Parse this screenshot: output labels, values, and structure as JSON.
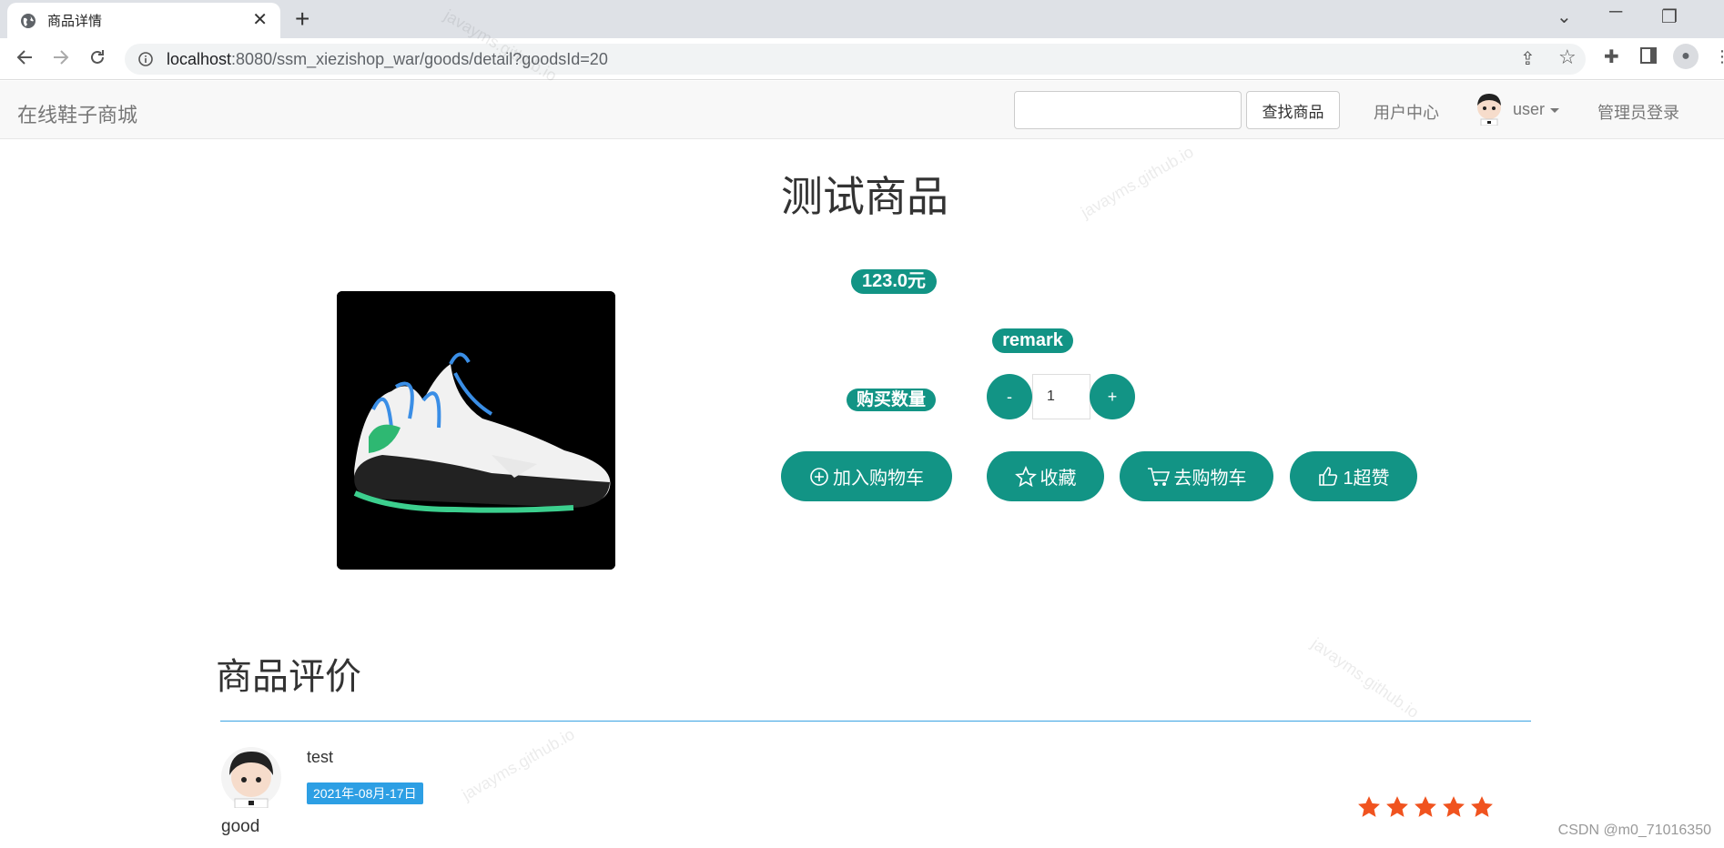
{
  "browser": {
    "tab_title": "商品详情",
    "url_host": "localhost",
    "url_path": ":8080/ssm_xiezishop_war/goods/detail?goodsId=20"
  },
  "navbar": {
    "brand": "在线鞋子商城",
    "search_placeholder": "",
    "search_button": "查找商品",
    "user_center": "用户中心",
    "username": "user",
    "admin_login": "管理员登录"
  },
  "product": {
    "name": "测试商品",
    "price": "123.0元",
    "remark": "remark",
    "quantity_label": "购买数量",
    "quantity": "1",
    "minus": "-",
    "plus": "+"
  },
  "actions": {
    "add_cart": "加入购物车",
    "favorite": "收藏",
    "go_cart": "去购物车",
    "like": "1超赞"
  },
  "reviews": {
    "title": "商品评价",
    "items": [
      {
        "user": "test",
        "date": "2021年-08月-17日",
        "content": "good",
        "rating": 5
      }
    ]
  },
  "footer_mark": "CSDN @m0_71016350",
  "colors": {
    "accent": "#129485",
    "star": "#f0531f",
    "date_badge": "#2d9fe4"
  }
}
